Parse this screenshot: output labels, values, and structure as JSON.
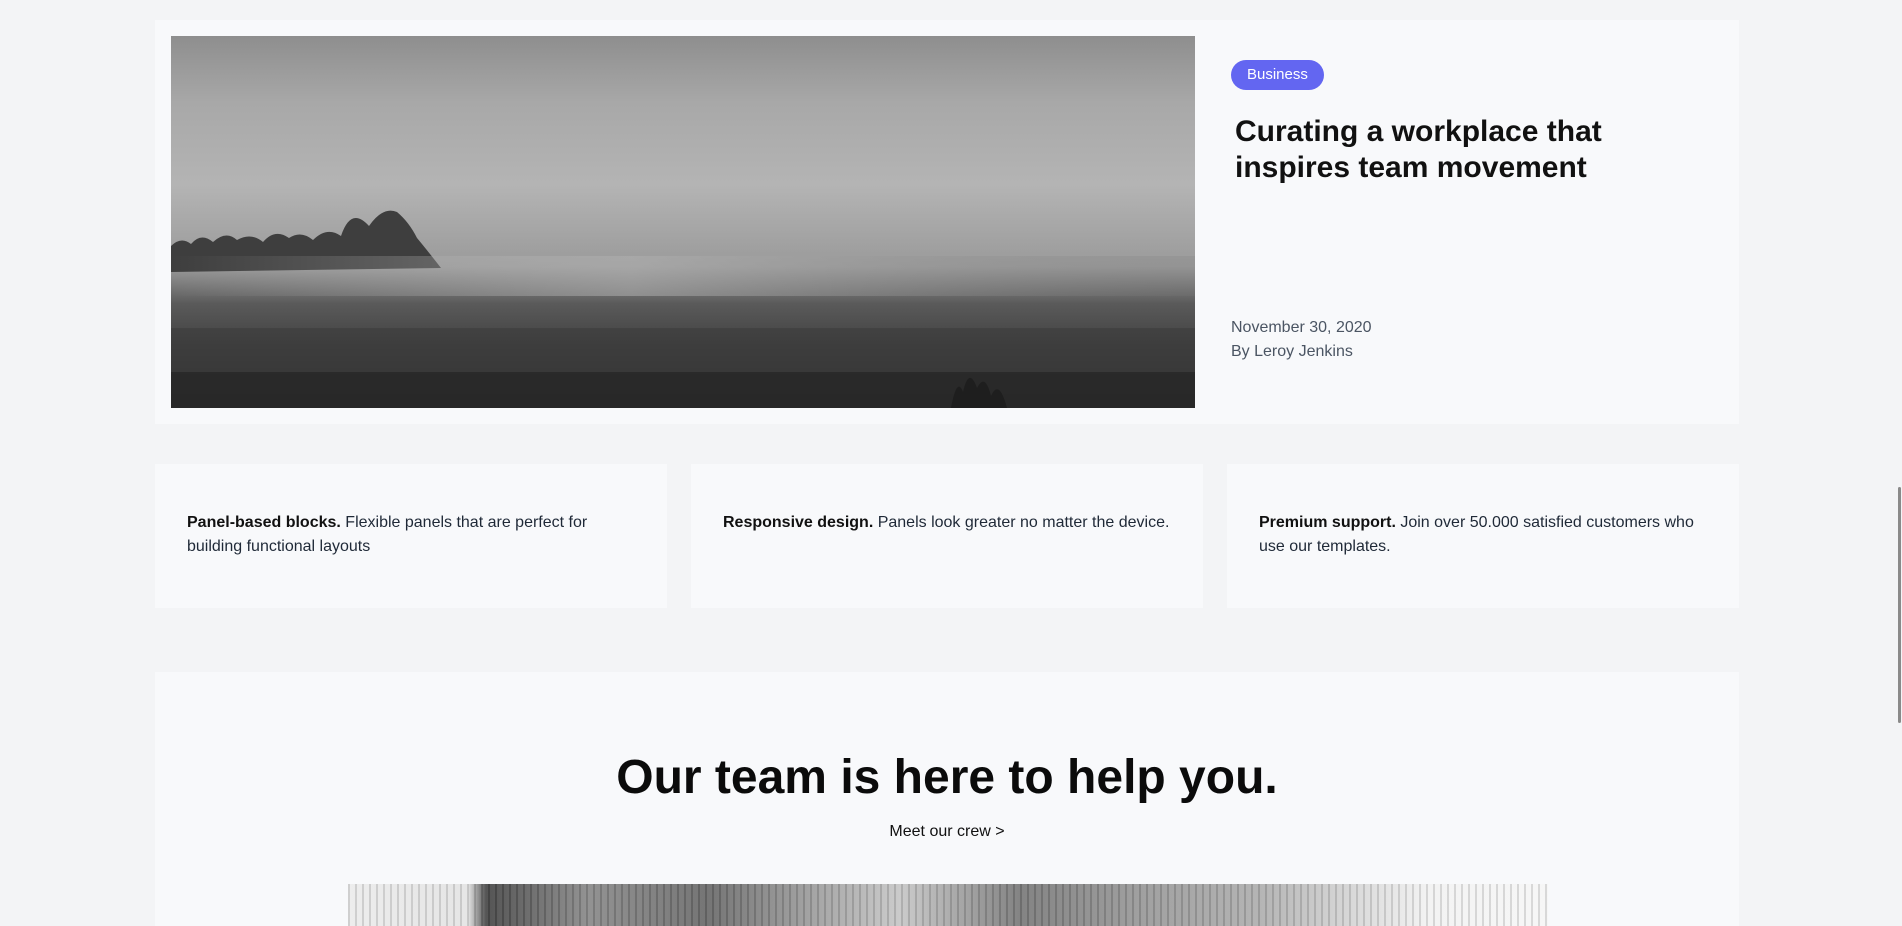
{
  "featured": {
    "category": "Business",
    "title": "Curating a workplace that inspires team movement",
    "date": "November 30, 2020",
    "author": "By Leroy Jenkins",
    "image_alt": "Foggy landscape with trees"
  },
  "features": [
    {
      "title": "Panel-based blocks.",
      "text": " Flexible panels that are perfect for building functional layouts"
    },
    {
      "title": "Responsive design.",
      "text": " Panels look greater no matter the device."
    },
    {
      "title": "Premium support.",
      "text": " Join over 50.000 satisfied customers who use our templates."
    }
  ],
  "team": {
    "heading": "Our team is here to help you.",
    "link": "Meet our crew >"
  },
  "colors": {
    "accent": "#6366f1",
    "page_background": "#f3f4f6",
    "card_background": "#f8f9fb"
  }
}
